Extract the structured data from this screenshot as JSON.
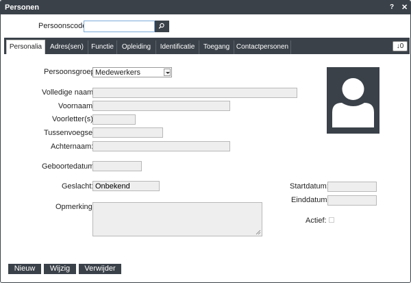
{
  "window": {
    "title": "Personen",
    "help_label": "?",
    "close_label": "✕"
  },
  "search": {
    "label": "Persoonscode:",
    "value": "",
    "placeholder": "",
    "button_icon": "search-icon"
  },
  "tabs": [
    {
      "label": "Personalia",
      "active": true
    },
    {
      "label": "Adres(sen)",
      "active": false
    },
    {
      "label": "Functie",
      "active": false
    },
    {
      "label": "Opleiding",
      "active": false
    },
    {
      "label": "Identificatie",
      "active": false
    },
    {
      "label": "Toegang",
      "active": false
    },
    {
      "label": "Contactpersonen",
      "active": false
    }
  ],
  "sort_button": {
    "label": "↓0"
  },
  "form": {
    "persoonsgroep": {
      "label": "Persoonsgroep:",
      "value": "Medewerkers"
    },
    "volledige_naam": {
      "label": "Volledige naam:",
      "value": ""
    },
    "voornaam": {
      "label": "Voornaam:",
      "value": ""
    },
    "voorletters": {
      "label": "Voorletter(s):",
      "value": ""
    },
    "tussenvoegsel": {
      "label": "Tussenvoegsel:",
      "value": ""
    },
    "achternaam": {
      "label": "Achternaam:",
      "value": ""
    },
    "geboortedatum": {
      "label": "Geboortedatum:",
      "value": ""
    },
    "geslacht": {
      "label": "Geslacht:",
      "value": "Onbekend"
    },
    "opmerking": {
      "label": "Opmerking:",
      "value": ""
    },
    "startdatum": {
      "label": "Startdatum:",
      "value": ""
    },
    "einddatum": {
      "label": "Einddatum:",
      "value": ""
    },
    "actief": {
      "label": "Actief:",
      "checked": false
    }
  },
  "buttons": {
    "nieuw": "Nieuw",
    "wijzig": "Wijzig",
    "verwijder": "Verwijder"
  },
  "colors": {
    "dark": "#3a4149",
    "field_bg": "#eeeeee",
    "focus_border": "#7aa9d8"
  }
}
